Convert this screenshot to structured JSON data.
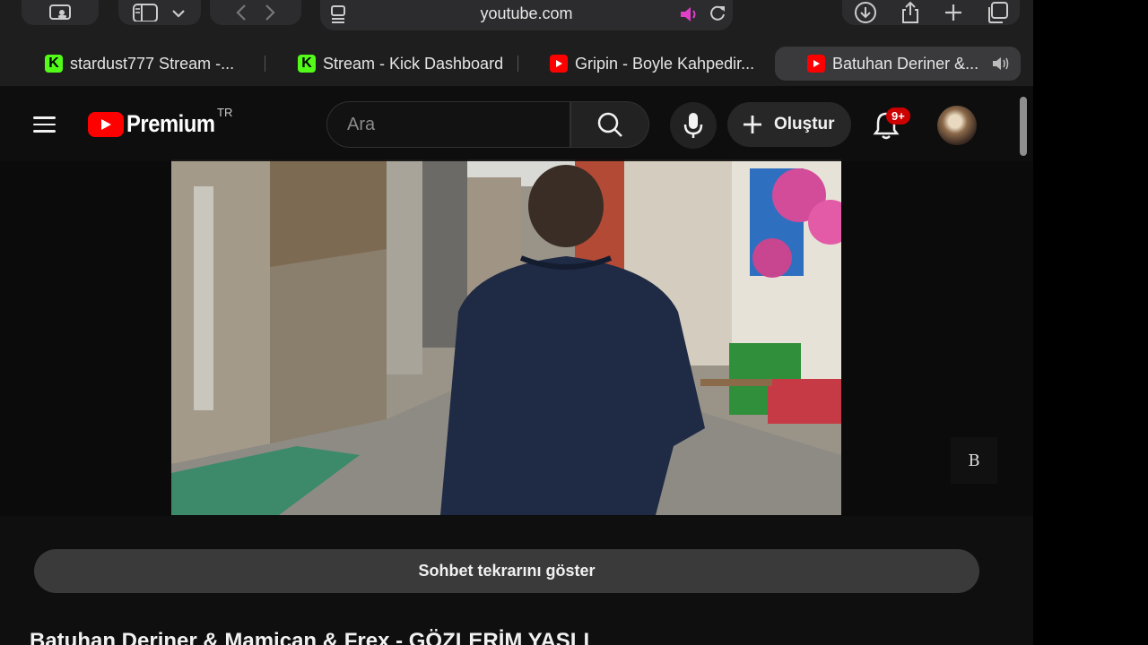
{
  "browser": {
    "url": "youtube.com"
  },
  "tabs": [
    {
      "label": "stardust777 Stream -...",
      "site": "kick"
    },
    {
      "label": "Stream - Kick Dashboard",
      "site": "kick"
    },
    {
      "label": "Gripin - Boyle Kahpedir...",
      "site": "youtube"
    },
    {
      "label": "Batuhan Deriner &...",
      "site": "youtube",
      "active": true
    }
  ],
  "youtube": {
    "logo_text": "Premium",
    "country_code": "TR",
    "search_placeholder": "Ara",
    "create_label": "Oluştur",
    "notifications_badge": "9+"
  },
  "video": {
    "watermark": "B"
  },
  "chat_replay_label": "Sohbet tekrarını göster",
  "video_title": "Batuhan Deriner & Mamican & Frex - GÖZLERİM YAŞLI",
  "colors": {
    "youtube_red": "#ff0000",
    "kick_green": "#53fc18",
    "badge_red": "#cc0000"
  }
}
